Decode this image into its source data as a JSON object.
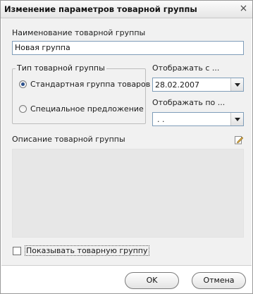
{
  "window": {
    "title": "Изменение параметров товарной группы",
    "close_glyph": "×"
  },
  "name_field": {
    "label": "Наименование товарной группы",
    "value": "Новая группа"
  },
  "type_group": {
    "legend": "Тип товарной группы",
    "options": [
      {
        "label": "Стандартная группа товаров",
        "checked": true
      },
      {
        "label": "Специальное предложение",
        "checked": false
      }
    ]
  },
  "display_from": {
    "label": "Отображать с ...",
    "value": "28.02.2007"
  },
  "display_to": {
    "label": "Отображать по ...",
    "value": ". ."
  },
  "description": {
    "label": "Описание товарной группы",
    "icon": "edit-pencil-icon",
    "value": ""
  },
  "show_group": {
    "label": "Показывать товарную группу",
    "checked": false
  },
  "buttons": {
    "ok": "OK",
    "cancel": "Отмена"
  }
}
